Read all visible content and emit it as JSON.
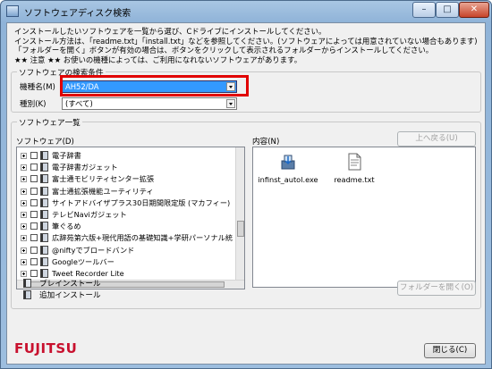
{
  "window": {
    "title": "ソフトウェアディスク検索",
    "min_symbol": "–",
    "max_symbol": "□",
    "close_symbol": "✕"
  },
  "intro": {
    "line1": "インストールしたいソフトウェアを一覧から選び、Cドライブにインストールしてください。",
    "line2": "インストール方法は、「readme.txt」「install.txt」などを参照してください。(ソフトウェアによっては用意されていない場合もあります)",
    "line3": "「フォルダーを開く」ボタンが有効の場合は、ボタンをクリックして表示されるフォルダーからインストールしてください。",
    "line4": "★★ 注意 ★★ お使いの機種によっては、ご利用になれないソフトウェアがあります。"
  },
  "search_conditions": {
    "group_label": "ソフトウェアの検索条件",
    "model_label": "機種名(M)",
    "model_value": "AH52/DA",
    "type_label": "種別(K)",
    "type_value": "(すべて)"
  },
  "software_list": {
    "group_label": "ソフトウェア一覧",
    "tree_label": "ソフトウェア(D)",
    "contents_label": "内容(N)",
    "up_button": "上へ戻る(U)",
    "items": [
      "電子辞書",
      "電子辞書ガジェット",
      "富士通モビリティセンター拡張",
      "富士通拡張機能ユーティリティ",
      "サイトアドバイザプラス30日期間限定版 (マカフィー)",
      "テレビNaviガジェット",
      "筆ぐるめ",
      "広辞苑第六版+現代用語の基礎知識+学研パーソナル統",
      "@niftyでブロードバンド",
      "Googleツールバー",
      "Tweet Recorder Lite"
    ],
    "files": [
      {
        "name": "infinst_autol.exe",
        "icon": "installer-icon"
      },
      {
        "name": "readme.txt",
        "icon": "text-file-icon"
      }
    ]
  },
  "legend": {
    "preinstall": "プレインストール",
    "additional": "追加インストール"
  },
  "buttons": {
    "open_folder": "フォルダーを開く(O)",
    "close": "閉じる(C)"
  },
  "brand": {
    "logo": "FUJITSU",
    "color": "#c8102e"
  }
}
